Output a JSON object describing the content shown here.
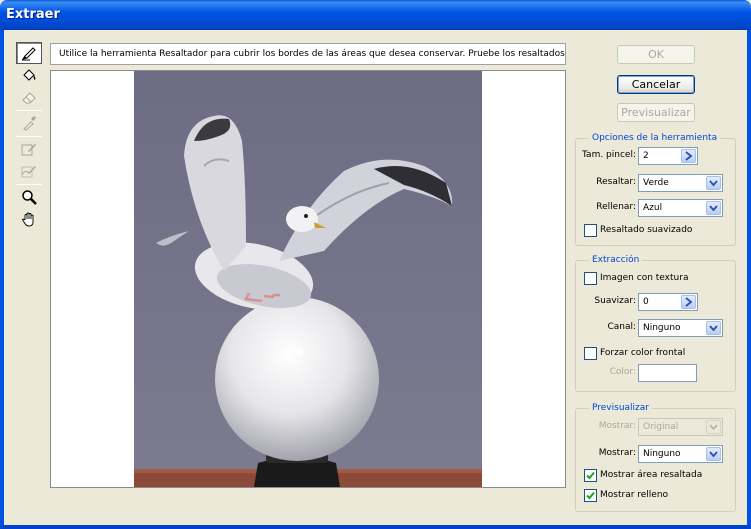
{
  "window": {
    "title": "Extraer"
  },
  "colors": {
    "titlebar": "#0055E5",
    "group_title": "#0046D5",
    "photo_sky": "#75738A",
    "check_mark": "#21A121"
  },
  "tools": [
    {
      "name": "edge-highlighter-tool-icon",
      "active": true
    },
    {
      "name": "fill-tool-icon",
      "active": false
    },
    {
      "name": "eraser-tool-icon",
      "active": false
    },
    {
      "name": "eyedropper-tool-icon",
      "active": false
    },
    {
      "name": "cleanup-tool-icon",
      "active": false
    },
    {
      "name": "edge-touchup-tool-icon",
      "active": false
    },
    {
      "name": "zoom-tool-icon",
      "active": false
    },
    {
      "name": "hand-tool-icon",
      "active": false
    }
  ],
  "instructions": "Utilice la herramienta Resaltador para cubrir los bordes de las áreas que desea conservar. Pruebe los resaltados suavizados e",
  "buttons": {
    "ok": "OK",
    "cancel": "Cancelar",
    "preview": "Previsualizar"
  },
  "tool_options": {
    "title": "Opciones de la herramienta",
    "brush_size_label": "Tam. pincel:",
    "brush_size_value": "2",
    "highlight_label": "Resaltar:",
    "highlight_value": "Verde",
    "fill_label": "Rellenar:",
    "fill_value": "Azul",
    "smart_highlight_label": "Resaltado suavizado",
    "smart_highlight_checked": false
  },
  "extraction": {
    "title": "Extracción",
    "textured_label": "Imagen con textura",
    "textured_checked": false,
    "smooth_label": "Suavizar:",
    "smooth_value": "0",
    "channel_label": "Canal:",
    "channel_value": "Ninguno",
    "force_fg_label": "Forzar color frontal",
    "force_fg_checked": false,
    "color_label": "Color:"
  },
  "preview_group": {
    "title": "Previsualizar",
    "show_label_1": "Mostrar:",
    "show_value_1": "Original",
    "show_label_2": "Mostrar:",
    "show_value_2": "Ninguno",
    "show_highlight_label": "Mostrar área resaltada",
    "show_highlight_checked": true,
    "show_fill_label": "Mostrar relleno",
    "show_fill_checked": true
  }
}
